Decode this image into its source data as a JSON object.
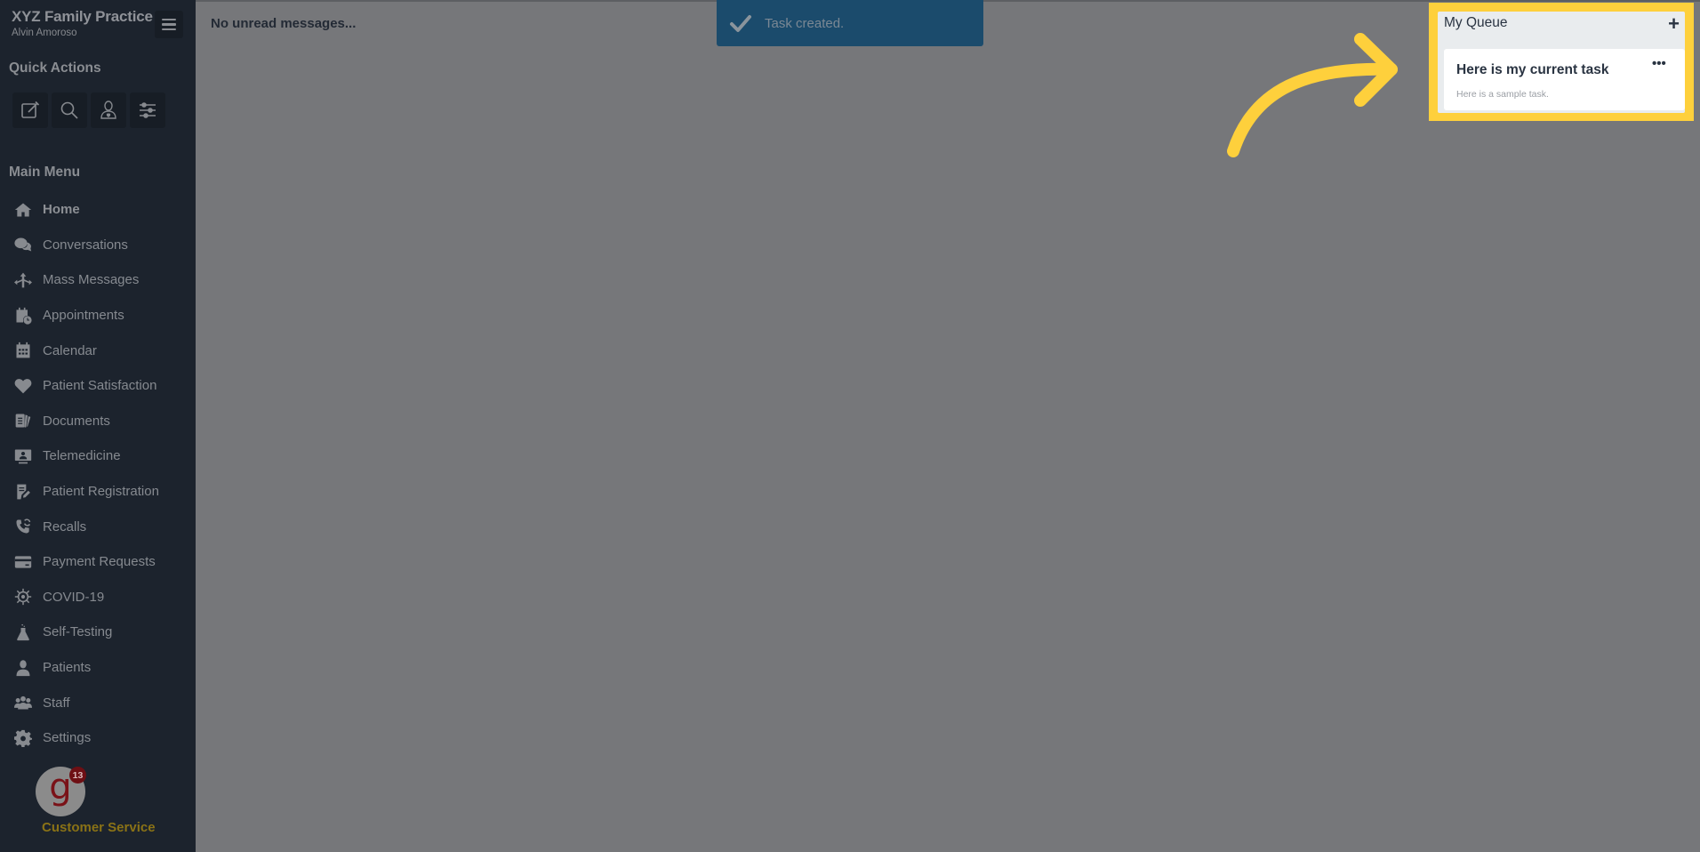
{
  "sidebar": {
    "practice_name": "XYZ Family Practice",
    "user_name": "Alvin Amoroso",
    "quick_actions_title": "Quick Actions",
    "quick_actions": [
      {
        "icon": "compose-icon",
        "label": "New"
      },
      {
        "icon": "search-icon",
        "label": "Search"
      },
      {
        "icon": "patient-icon",
        "label": "Patient"
      },
      {
        "icon": "sliders-icon",
        "label": "Filters"
      }
    ],
    "main_menu_title": "Main Menu",
    "items": [
      {
        "label": "Home",
        "icon": "home-icon",
        "active": true
      },
      {
        "label": "Conversations",
        "icon": "chat-icon"
      },
      {
        "label": "Mass Messages",
        "icon": "split-arrows-icon"
      },
      {
        "label": "Appointments",
        "icon": "calendar-clock-icon"
      },
      {
        "label": "Calendar",
        "icon": "calendar-icon"
      },
      {
        "label": "Patient Satisfaction",
        "icon": "heart-icon"
      },
      {
        "label": "Documents",
        "icon": "documents-icon"
      },
      {
        "label": "Telemedicine",
        "icon": "monitor-user-icon"
      },
      {
        "label": "Patient Registration",
        "icon": "registration-icon"
      },
      {
        "label": "Recalls",
        "icon": "phone-refresh-icon"
      },
      {
        "label": "Payment Requests",
        "icon": "credit-card-icon"
      },
      {
        "label": "COVID-19",
        "icon": "virus-icon"
      },
      {
        "label": "Self-Testing",
        "icon": "flask-icon"
      },
      {
        "label": "Patients",
        "icon": "patient-icon"
      },
      {
        "label": "Staff",
        "icon": "staff-icon"
      },
      {
        "label": "Settings",
        "icon": "gear-icon"
      }
    ],
    "customer_service": {
      "logo_letter": "g",
      "badge_count": "13",
      "label": "Customer Service"
    }
  },
  "main": {
    "unread_text": "No unread messages...",
    "toast": {
      "message": "Task created."
    },
    "queue": {
      "title": "My Queue",
      "add_label": "+",
      "tasks": [
        {
          "title": "Here is my current task",
          "description": "Here is a sample task.",
          "menu_label": "•••"
        }
      ]
    }
  },
  "colors": {
    "sidebar_bg": "#1c232d",
    "overlay_bg": "#76777a",
    "toast_bg": "#1b4b6c",
    "highlight": "#fed03c",
    "cs_label": "#8a7216",
    "badge": "#6e0f14"
  }
}
